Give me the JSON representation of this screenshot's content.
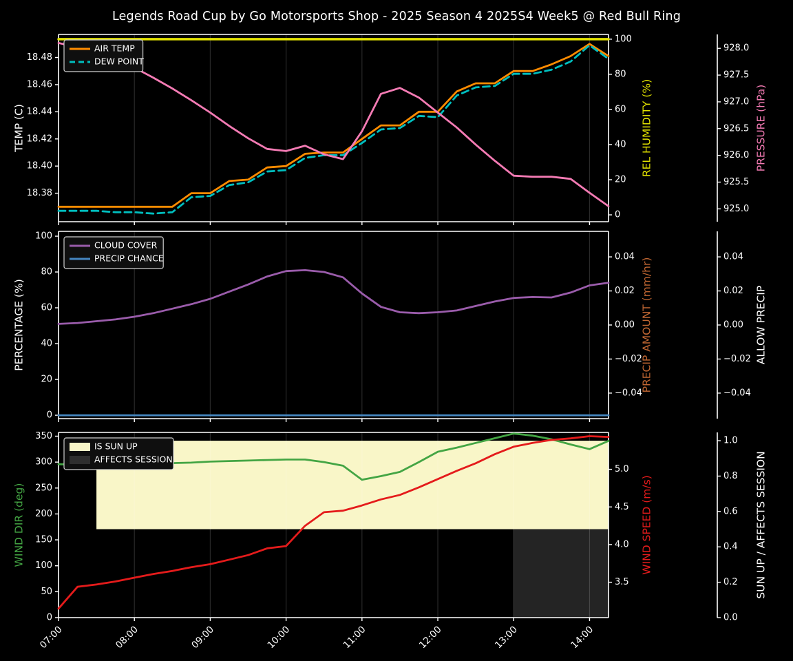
{
  "title": "Legends Road Cup by Go Motorsports Shop - 2025 Season 4 2025S4 Week5 @ Red Bull Ring",
  "figure": {
    "background": "#000000",
    "text_color": "#ffffff",
    "grid_color": "rgba(255,255,255,0.16)"
  },
  "x_axis": {
    "tick_labels": [
      "07:00",
      "08:00",
      "09:00",
      "10:00",
      "11:00",
      "12:00",
      "13:00",
      "14:00"
    ],
    "tick_hours": [
      7,
      8,
      9,
      10,
      11,
      12,
      13,
      14
    ],
    "range_hours": [
      7.0,
      14.25
    ]
  },
  "chart_data": [
    {
      "type": "line",
      "panel": "temperature",
      "x_hours": [
        7,
        7.25,
        7.5,
        7.75,
        8,
        8.25,
        8.5,
        8.75,
        9,
        9.25,
        9.5,
        9.75,
        10,
        10.25,
        10.5,
        10.75,
        11,
        11.25,
        11.5,
        11.75,
        12,
        12.25,
        12.5,
        12.75,
        13,
        13.25,
        13.5,
        13.75,
        14,
        14.25
      ],
      "series": [
        {
          "name": "AIR TEMP",
          "axis": "left",
          "color": "#ff8c00",
          "style": "solid",
          "visible": true,
          "values": [
            18.37,
            18.37,
            18.37,
            18.37,
            18.37,
            18.37,
            18.37,
            18.38,
            18.38,
            18.389,
            18.39,
            18.399,
            18.4,
            18.409,
            18.41,
            18.41,
            18.42,
            18.43,
            18.43,
            18.44,
            18.44,
            18.455,
            18.461,
            18.461,
            18.47,
            18.47,
            18.475,
            18.481,
            18.49,
            18.481
          ]
        },
        {
          "name": "DEW POINT",
          "axis": "left",
          "color": "#00bfbf",
          "style": "dashed",
          "visible": true,
          "values": [
            18.367,
            18.367,
            18.367,
            18.366,
            18.366,
            18.365,
            18.366,
            18.377,
            18.378,
            18.386,
            18.388,
            18.396,
            18.397,
            18.406,
            18.408,
            18.408,
            18.417,
            18.427,
            18.428,
            18.437,
            18.436,
            18.452,
            18.458,
            18.459,
            18.468,
            18.468,
            18.471,
            18.477,
            18.489,
            18.479
          ]
        },
        {
          "name": "REL HUMIDITY",
          "axis": "right1",
          "color": "#e3e300",
          "style": "solid",
          "visible": true,
          "width": 3.5,
          "values": [
            100,
            100,
            100,
            100,
            100,
            100,
            100,
            100,
            100,
            100,
            100,
            100,
            100,
            100,
            100,
            100,
            100,
            100,
            100,
            100,
            100,
            100,
            100,
            100,
            100,
            100,
            100,
            100,
            100,
            100
          ]
        },
        {
          "name": "PRESSURE",
          "axis": "right2",
          "color": "#f47bb4",
          "style": "solid",
          "visible": true,
          "values": [
            928.1,
            928.02,
            927.9,
            927.78,
            927.64,
            927.45,
            927.25,
            927.03,
            926.8,
            926.55,
            926.32,
            926.12,
            926.08,
            926.18,
            926.02,
            925.93,
            926.45,
            927.15,
            927.26,
            927.08,
            926.8,
            926.52,
            926.2,
            925.9,
            925.62,
            925.6,
            925.6,
            925.56,
            925.3,
            925.05
          ]
        }
      ],
      "axes": {
        "left": {
          "label": "TEMP (C)",
          "color": "#ffffff",
          "range": [
            18.359,
            18.497
          ],
          "ticks": [
            18.38,
            18.4,
            18.42,
            18.44,
            18.46,
            18.48
          ],
          "tick_labels": [
            "18.38",
            "18.40",
            "18.42",
            "18.44",
            "18.46",
            "18.48"
          ]
        },
        "right1": {
          "label": "REL HUMIDITY (%)",
          "color": "#e3e300",
          "range": [
            -3.9,
            102.7
          ],
          "ticks": [
            0,
            20,
            40,
            60,
            80,
            100
          ],
          "tick_labels": [
            "0",
            "20",
            "40",
            "60",
            "80",
            "100"
          ]
        },
        "right2": {
          "label": "PRESSURE (hPa)",
          "color": "#f47bb4",
          "range": [
            924.76,
            928.26
          ],
          "ticks": [
            925.0,
            925.5,
            926.0,
            926.5,
            927.0,
            927.5,
            928.0
          ],
          "tick_labels": [
            "925.0",
            "925.5",
            "926.0",
            "926.5",
            "927.0",
            "927.5",
            "928.0"
          ]
        }
      },
      "legend": {
        "position": "top-left",
        "entries": [
          {
            "label": "AIR TEMP",
            "color": "#ff8c00",
            "type": "line",
            "dash": false
          },
          {
            "label": "DEW POINT",
            "color": "#00bfbf",
            "type": "line",
            "dash": true
          }
        ]
      }
    },
    {
      "type": "line",
      "panel": "precipitation",
      "x_hours": [
        7,
        7.25,
        7.5,
        7.75,
        8,
        8.25,
        8.5,
        8.75,
        9,
        9.25,
        9.5,
        9.75,
        10,
        10.25,
        10.5,
        10.75,
        11,
        11.25,
        11.5,
        11.75,
        12,
        12.25,
        12.5,
        12.75,
        13,
        13.25,
        13.5,
        13.75,
        14,
        14.25
      ],
      "series": [
        {
          "name": "CLOUD COVER",
          "axis": "left",
          "color": "#9a5cab",
          "style": "solid",
          "visible": true,
          "values": [
            51,
            51.5,
            52.5,
            53.5,
            55,
            57,
            59.5,
            62,
            65,
            69,
            73,
            77.5,
            80.5,
            81,
            80,
            77,
            68,
            60.5,
            57.5,
            57,
            57.5,
            58.5,
            61,
            63.5,
            65.5,
            66,
            65.8,
            68.5,
            72.5,
            74
          ]
        },
        {
          "name": "PRECIP CHANCE",
          "axis": "left",
          "color": "#4586c0",
          "style": "solid",
          "visible": true,
          "values": [
            0,
            0,
            0,
            0,
            0,
            0,
            0,
            0,
            0,
            0,
            0,
            0,
            0,
            0,
            0,
            0,
            0,
            0,
            0,
            0,
            0,
            0,
            0,
            0,
            0,
            0,
            0,
            0,
            0,
            0
          ]
        },
        {
          "name": "PRECIP AMOUNT",
          "axis": "right1",
          "color": "#c06632",
          "style": "solid",
          "visible": false,
          "values": [
            0,
            0,
            0,
            0,
            0,
            0,
            0,
            0,
            0,
            0,
            0,
            0,
            0,
            0,
            0,
            0,
            0,
            0,
            0,
            0,
            0,
            0,
            0,
            0,
            0,
            0,
            0,
            0,
            0,
            0
          ]
        },
        {
          "name": "ALLOW PRECIP",
          "axis": "right2",
          "color": "#ffffff",
          "style": "solid",
          "visible": false,
          "values": [
            0,
            0,
            0,
            0,
            0,
            0,
            0,
            0,
            0,
            0,
            0,
            0,
            0,
            0,
            0,
            0,
            0,
            0,
            0,
            0,
            0,
            0,
            0,
            0,
            0,
            0,
            0,
            0,
            0,
            0
          ]
        }
      ],
      "axes": {
        "left": {
          "label": "PERCENTAGE (%)",
          "color": "#ffffff",
          "range": [
            -1.9,
            102.7
          ],
          "ticks": [
            0,
            20,
            40,
            60,
            80,
            100
          ],
          "tick_labels": [
            "0",
            "20",
            "40",
            "60",
            "80",
            "100"
          ]
        },
        "right1": {
          "label": "PRECIP AMOUNT (mm/hr)",
          "color": "#c06632",
          "range": [
            -0.055,
            0.055
          ],
          "ticks": [
            -0.04,
            -0.02,
            0,
            0.02,
            0.04
          ],
          "tick_labels": [
            "−0.04",
            "−0.02",
            "0.00",
            "0.02",
            "0.04"
          ]
        },
        "right2": {
          "label": "ALLOW PRECIP",
          "color": "#ffffff",
          "range": [
            -0.055,
            0.055
          ],
          "ticks": [
            -0.04,
            -0.02,
            0,
            0.02,
            0.04
          ],
          "tick_labels": [
            "−0.04",
            "−0.02",
            "0.00",
            "0.02",
            "0.04"
          ]
        }
      },
      "legend": {
        "position": "top-left",
        "entries": [
          {
            "label": "CLOUD COVER",
            "color": "#9a5cab",
            "type": "line",
            "dash": false
          },
          {
            "label": "PRECIP CHANCE",
            "color": "#4586c0",
            "type": "line",
            "dash": false
          }
        ]
      }
    },
    {
      "type": "line",
      "panel": "wind-sun",
      "x_hours": [
        7,
        7.25,
        7.5,
        7.75,
        8,
        8.25,
        8.5,
        8.75,
        9,
        9.25,
        9.5,
        9.75,
        10,
        10.25,
        10.5,
        10.75,
        11,
        11.25,
        11.5,
        11.75,
        12,
        12.25,
        12.5,
        12.75,
        13,
        13.25,
        13.5,
        13.75,
        14,
        14.25
      ],
      "series": [
        {
          "name": "IS SUN UP",
          "axis": "right2",
          "color": "#f9f6c8",
          "style": "fill",
          "visible": true,
          "band": [
            0.5,
            1.0
          ],
          "values": [
            0,
            0,
            1,
            1,
            1,
            1,
            1,
            1,
            1,
            1,
            1,
            1,
            1,
            1,
            1,
            1,
            1,
            1,
            1,
            1,
            1,
            1,
            1,
            1,
            1,
            1,
            1,
            1,
            1,
            1
          ]
        },
        {
          "name": "AFFECTS SESSION",
          "axis": "right2",
          "color": "#242424",
          "style": "fill",
          "visible": true,
          "band": [
            0.0,
            0.5
          ],
          "values": [
            0,
            0,
            0,
            0,
            0,
            0,
            0,
            0,
            0,
            0,
            0,
            0,
            0,
            0,
            0,
            0,
            0,
            0,
            0,
            0,
            0,
            0,
            0,
            0,
            1,
            1,
            1,
            1,
            1,
            1
          ]
        },
        {
          "name": "WIND DIR",
          "axis": "left",
          "color": "#44a544",
          "style": "solid",
          "visible": true,
          "values": [
            296,
            295,
            295,
            295,
            296,
            297,
            298,
            299,
            301,
            302,
            303,
            304,
            305,
            305,
            300,
            293,
            266,
            273,
            281,
            300,
            320,
            328,
            337,
            346,
            355,
            351,
            344,
            334,
            325,
            341
          ]
        },
        {
          "name": "WIND SPEED",
          "axis": "right1",
          "color": "#e41b1b",
          "style": "solid",
          "visible": true,
          "values": [
            3.15,
            3.44,
            3.47,
            3.51,
            3.56,
            3.61,
            3.65,
            3.7,
            3.74,
            3.8,
            3.86,
            3.95,
            3.98,
            4.25,
            4.43,
            4.45,
            4.52,
            4.6,
            4.66,
            4.76,
            4.87,
            4.98,
            5.08,
            5.2,
            5.3,
            5.35,
            5.39,
            5.41,
            5.44,
            5.43
          ]
        }
      ],
      "axes": {
        "left": {
          "label": "WIND DIR (deg)",
          "color": "#44a544",
          "range": [
            0,
            357.3
          ],
          "ticks": [
            0,
            50,
            100,
            150,
            200,
            250,
            300,
            350
          ],
          "tick_labels": [
            "0",
            "50",
            "100",
            "150",
            "200",
            "250",
            "300",
            "350"
          ]
        },
        "right1": {
          "label": "WIND SPEED (m/s)",
          "color": "#e41b1b",
          "range": [
            3.03,
            5.49
          ],
          "ticks": [
            3.5,
            4.0,
            4.5,
            5.0
          ],
          "tick_labels": [
            "3.5",
            "4.0",
            "4.5",
            "5.0"
          ]
        },
        "right2": {
          "label": "SUN UP / AFFECTS SESSION",
          "color": "#ffffff",
          "range": [
            0,
            1.047
          ],
          "ticks": [
            0,
            0.2,
            0.4,
            0.6,
            0.8,
            1.0
          ],
          "tick_labels": [
            "0.0",
            "0.2",
            "0.4",
            "0.6",
            "0.8",
            "1.0"
          ]
        }
      },
      "legend": {
        "position": "top-left",
        "entries": [
          {
            "label": "IS SUN UP",
            "color": "#f9f6c8",
            "type": "patch",
            "dash": false
          },
          {
            "label": "AFFECTS SESSION",
            "color": "#2e2e2e",
            "type": "patch",
            "dash": false
          }
        ]
      }
    }
  ]
}
